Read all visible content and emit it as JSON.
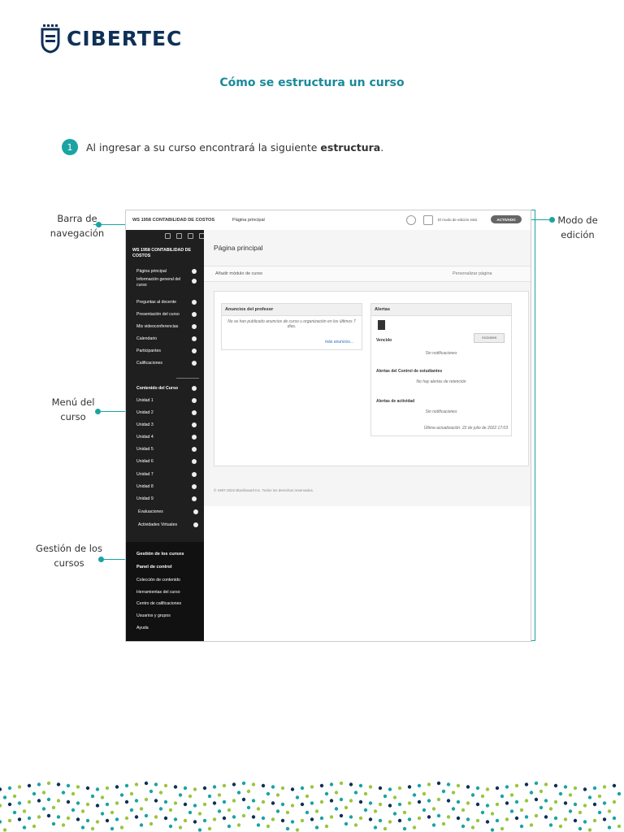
{
  "brand": {
    "name": "CIBERTEC"
  },
  "title": "Cómo se estructura un curso",
  "step": {
    "number": "1",
    "text_before": "Al ingresar a su curso encontrará la siguiente ",
    "text_bold": "estructura",
    "text_after": "."
  },
  "callouts": {
    "nav": "Barra de navegación",
    "menu": "Menú del curso",
    "gestion": "Gestión de los cursos",
    "modo": "Modo de edición"
  },
  "screenshot": {
    "topbar": {
      "course": "WS 1958 CONTABILIDAD DE COSTOS",
      "page": "Página principal",
      "mode_label": "El modo de edición está",
      "mode_badge": "ACTIVADO"
    },
    "sidebar": {
      "course": "WS 1958 CONTABILIDAD DE COSTOS",
      "items": [
        "Página principal",
        "Información general del curso",
        "Preguntas al docente",
        "Presentación del curso",
        "Mis videoconferencias",
        "Calendario",
        "Participantes",
        "Calificaciones"
      ],
      "content_header": "Contenido del Curso",
      "units": [
        "Unidad 1",
        "Unidad 2",
        "Unidad 3",
        "Unidad 4",
        "Unidad 5",
        "Unidad 6",
        "Unidad 7",
        "Unidad 8",
        "Unidad 9",
        "Evaluaciones",
        "Actividades Virtuales"
      ],
      "gestion_header": "Gestión de los cursos",
      "panel": "Panel de control",
      "panel_items": [
        "Colección de contenido",
        "Herramientas del curso",
        "Centro de calificaciones",
        "Usuarios y grupos",
        "Ayuda"
      ]
    },
    "main": {
      "page_title": "Página principal",
      "add_module": "Añadir módulo de curso",
      "customize": "Personalizar página",
      "announcements": {
        "title": "Anuncios del profesor",
        "text": "No se han publicado anuncios de curso u organización en los últimos 7 días.",
        "more": "más anuncios..."
      },
      "alerts": {
        "title": "Alertas",
        "vencido": "Vencido",
        "actions": "Acciones",
        "no_notif": "Sin notificaciones",
        "control_title": "Alertas del Control de estudiantes",
        "no_retention": "No hay alertas de retención",
        "activity_title": "Alertas de actividad",
        "no_notif2": "Sin notificaciones",
        "updated": "Última actualización: 22 de julio de 2022 17:03"
      },
      "footer": "© 1997-2022 Blackboard Inc. Todos los derechos reservados."
    }
  }
}
